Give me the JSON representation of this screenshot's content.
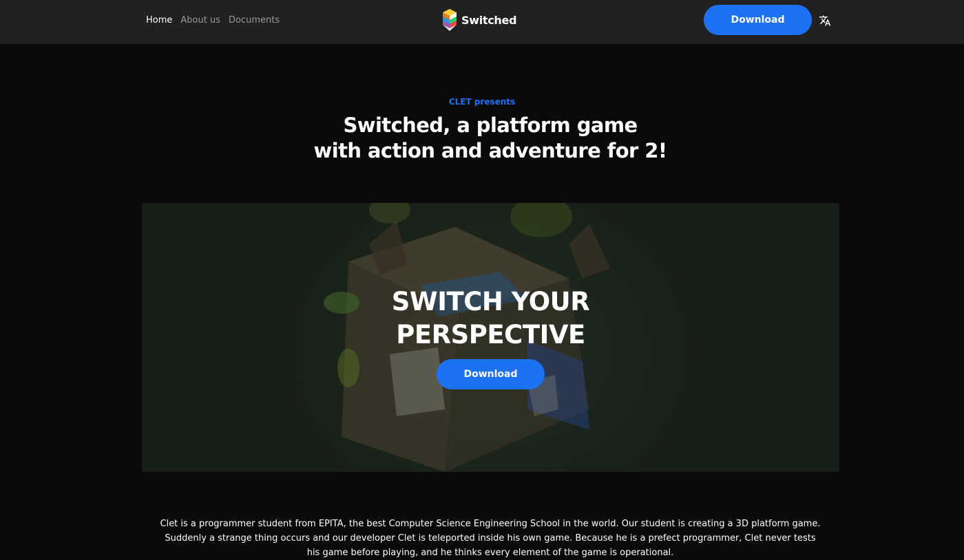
{
  "nav": {
    "links": [
      {
        "label": "Home",
        "active": true
      },
      {
        "label": "About us",
        "active": false
      },
      {
        "label": "Documents",
        "active": false
      }
    ],
    "brand": "Switched",
    "download_label": "Download",
    "translate_icon": "translate-icon"
  },
  "intro": {
    "presents": "CLET presents",
    "headline_line1": "Switched, a platform game",
    "headline_line2": "with action and adventure for 2!"
  },
  "hero": {
    "title_line1": "SWITCH YOUR",
    "title_line2": "PERSPECTIVE",
    "download_label": "Download"
  },
  "story": {
    "text": "Clet is a programmer student from EPITA, the best Computer Science Engineering School in the world. Our student is creating a 3D platform game. Suddenly a strange thing occurs and our developer Clet is teleported inside his own game. Because he is a prefect programmer, Clet never tests his game before playing, and he thinks every element of the game is operational."
  },
  "colors": {
    "accent": "#1d72f3",
    "navbar": "#212121",
    "background": "#0a0a0a"
  }
}
